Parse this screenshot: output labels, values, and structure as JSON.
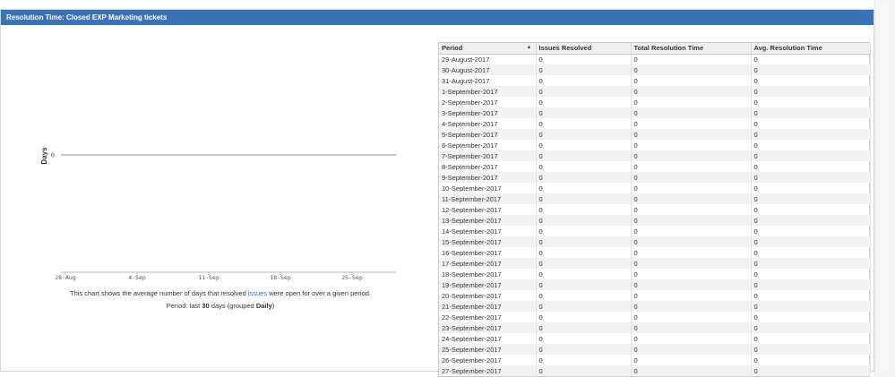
{
  "gadget": {
    "title": "Resolution Time: Closed EXP Marketing tickets"
  },
  "chart_data": {
    "type": "line",
    "ylabel": "Days",
    "xlabel": "",
    "x_ticks": [
      "28-Aug",
      "4-Sep",
      "11-Sep",
      "18-Sep",
      "25-Sep"
    ],
    "y_ticks": [
      "0"
    ],
    "series": [
      {
        "values": [
          0
        ]
      }
    ]
  },
  "description": {
    "prefix": "This chart shows the average number of days that resolved ",
    "link": "issues",
    "suffix": " were open for over a given period."
  },
  "period": {
    "prefix": "Period: last ",
    "days": "30",
    "middle": " days (grouped ",
    "grouping": "Daily",
    "suffix": ")"
  },
  "table": {
    "columns": [
      "Period",
      "Issues Resolved",
      "Total Resolution Time",
      "Avg. Resolution Time"
    ],
    "sort_icon": "sort-ascending-icon",
    "rows": [
      [
        "29-August-2017",
        "0",
        "0",
        "0"
      ],
      [
        "30-August-2017",
        "0",
        "0",
        "0"
      ],
      [
        "31-August-2017",
        "0",
        "0",
        "0"
      ],
      [
        "1-September-2017",
        "0",
        "0",
        "0"
      ],
      [
        "2-September-2017",
        "0",
        "0",
        "0"
      ],
      [
        "3-September-2017",
        "0",
        "0",
        "0"
      ],
      [
        "4-September-2017",
        "0",
        "0",
        "0"
      ],
      [
        "5-September-2017",
        "0",
        "0",
        "0"
      ],
      [
        "6-September-2017",
        "0",
        "0",
        "0"
      ],
      [
        "7-September-2017",
        "0",
        "0",
        "0"
      ],
      [
        "8-September-2017",
        "0",
        "0",
        "0"
      ],
      [
        "9-September-2017",
        "0",
        "0",
        "0"
      ],
      [
        "10-September-2017",
        "0",
        "0",
        "0"
      ],
      [
        "11-September-2017",
        "0",
        "0",
        "0"
      ],
      [
        "12-September-2017",
        "0",
        "0",
        "0"
      ],
      [
        "13-September-2017",
        "0",
        "0",
        "0"
      ],
      [
        "14-September-2017",
        "0",
        "0",
        "0"
      ],
      [
        "15-September-2017",
        "0",
        "0",
        "0"
      ],
      [
        "16-September-2017",
        "0",
        "0",
        "0"
      ],
      [
        "17-September-2017",
        "0",
        "0",
        "0"
      ],
      [
        "18-September-2017",
        "0",
        "0",
        "0"
      ],
      [
        "19-September-2017",
        "0",
        "0",
        "0"
      ],
      [
        "20-September-2017",
        "0",
        "0",
        "0"
      ],
      [
        "21-September-2017",
        "0",
        "0",
        "0"
      ],
      [
        "22-September-2017",
        "0",
        "0",
        "0"
      ],
      [
        "23-September-2017",
        "0",
        "0",
        "0"
      ],
      [
        "24-September-2017",
        "0",
        "0",
        "0"
      ],
      [
        "25-September-2017",
        "0",
        "0",
        "0"
      ],
      [
        "26-September-2017",
        "0",
        "0",
        "0"
      ],
      [
        "27-September-2017",
        "0",
        "0",
        "0"
      ]
    ]
  },
  "colors": {
    "title_bar": "#3b73b9",
    "link": "#3b73b9",
    "row_alt": "#f2f2f2",
    "header_bg": "#efefef"
  }
}
